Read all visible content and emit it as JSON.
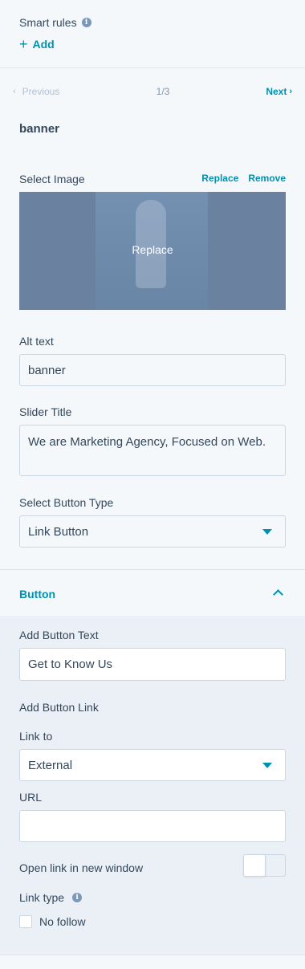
{
  "smart_rules": {
    "label": "Smart rules",
    "info_icon": "info-icon",
    "add_label": "Add"
  },
  "pager": {
    "previous_label": "Previous",
    "count": "1/3",
    "next_label": "Next"
  },
  "module": {
    "title": "banner"
  },
  "image": {
    "label": "Select Image",
    "replace_action": "Replace",
    "remove_action": "Remove",
    "overlay_label": "Replace"
  },
  "alt_text": {
    "label": "Alt text",
    "value": "banner"
  },
  "slider_title": {
    "label": "Slider Title",
    "value": "We are Marketing Agency, Focused on Web."
  },
  "button_type": {
    "label": "Select Button Type",
    "selected": "Link Button"
  },
  "button_section": {
    "title": "Button",
    "expanded": true,
    "text_label": "Add Button Text",
    "text_value": "Get to Know Us",
    "link_heading": "Add Button Link",
    "link_to_label": "Link to",
    "link_to_selected": "External",
    "url_label": "URL",
    "url_value": "",
    "new_window_label": "Open link in new window",
    "new_window_enabled": false,
    "link_type_label": "Link type",
    "no_follow_label": "No follow",
    "no_follow_checked": false
  },
  "colors": {
    "accent": "#0091ae",
    "text": "#33475b",
    "panel": "#f5f8fa",
    "subpanel": "#eaf0f6",
    "border": "#cbd6e2",
    "image_overlay": "#6a829f"
  }
}
